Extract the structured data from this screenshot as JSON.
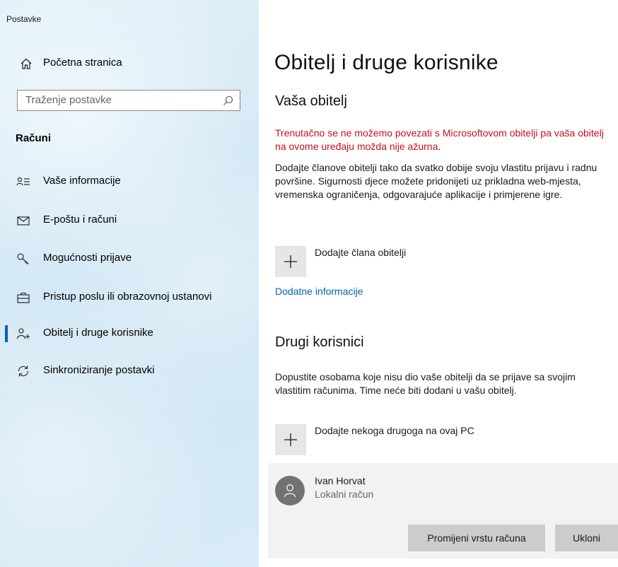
{
  "window": {
    "title": "Postavke"
  },
  "sidebar": {
    "home_label": "Početna stranica",
    "search_placeholder": "Traženje postavke",
    "section_title": "Računi",
    "items": [
      {
        "label": "Vaše informacije",
        "icon": "contact-info-icon",
        "selected": false
      },
      {
        "label": "E-poštu i računi",
        "icon": "mail-icon",
        "selected": false
      },
      {
        "label": "Mogućnosti prijave",
        "icon": "key-icon",
        "selected": false
      },
      {
        "label": "Pristup poslu ili obrazovnoj ustanovi",
        "icon": "briefcase-icon",
        "selected": false
      },
      {
        "label": "Obitelj i druge korisnike",
        "icon": "add-person-icon",
        "selected": true
      },
      {
        "label": "Sinkroniziranje postavki",
        "icon": "sync-icon",
        "selected": false
      }
    ]
  },
  "main": {
    "title": "Obitelj i druge korisnike",
    "family": {
      "heading": "Vaša obitelj",
      "error": "Trenutačno se ne možemo povezati s Microsoftovom obitelji pa vaša obitelj na ovome uređaju možda nije ažurna.",
      "description": "Dodajte članove obitelji tako da svatko dobije svoju vlastitu prijavu i radnu površine. Sigurnosti djece možete pridonijeti uz prikladna web-mjesta, vremenska ograničenja, odgovarajuće aplikacije i primjerene igre.",
      "add_label": "Dodajte člana obitelji",
      "more_info": "Dodatne informacije"
    },
    "others": {
      "heading": "Drugi korisnici",
      "description": "Dopustite osobama koje nisu dio vaše obitelji da se prijave sa svojim vlastitim računima. Time neće biti dodani u vašu obitelj.",
      "add_label": "Dodajte nekoga drugoga na ovaj PC",
      "user": {
        "name": "Ivan Horvat",
        "type": "Lokalni račun",
        "change_button": "Promijeni vrstu računa",
        "remove_button": "Ukloni"
      }
    }
  },
  "colors": {
    "accent": "#0063b1",
    "error": "#c50f1f",
    "tile": "#e6e6e6",
    "card": "#f2f2f2",
    "button": "#cccccc"
  }
}
